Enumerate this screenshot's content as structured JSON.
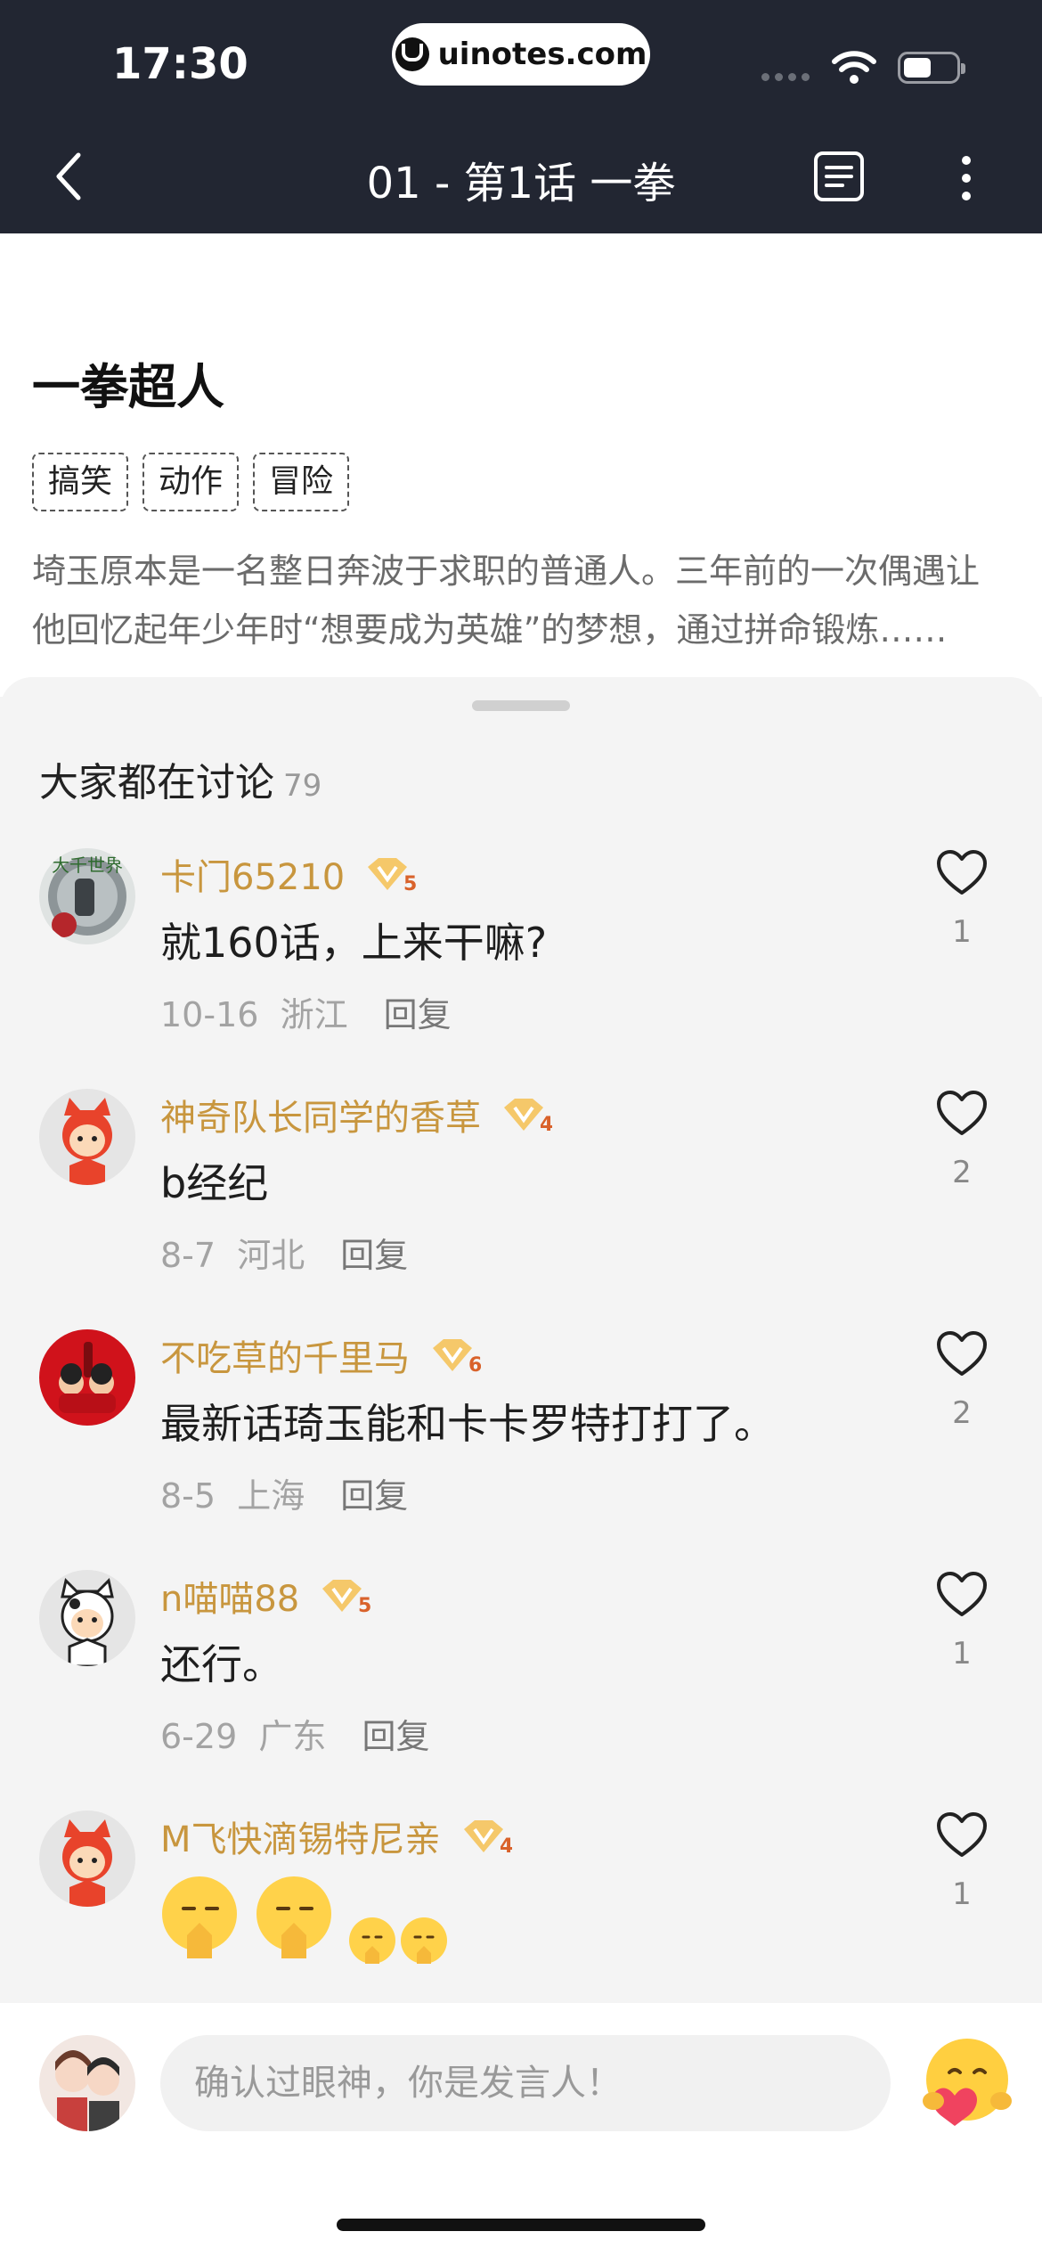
{
  "status_bar": {
    "time": "17:30",
    "site": "uinotes.com"
  },
  "nav": {
    "title": "01 - 第1话 一拳"
  },
  "book": {
    "title": "一拳超人",
    "tags": [
      "搞笑",
      "动作",
      "冒险"
    ],
    "description": "埼玉原本是一名整日奔波于求职的普通人。三年前的一次偶遇让他回忆起年少年时“想要成为英雄”的梦想，通过拼命锻炼……"
  },
  "comments_section": {
    "title": "大家都在讨论",
    "count": "79",
    "comments": [
      {
        "user": "卡门65210",
        "level": "5",
        "text": "就160话，上来干嘛?",
        "date": "10-16",
        "location": "浙江",
        "reply": "回复",
        "likes": "1",
        "avatar": "photo-avatar"
      },
      {
        "user": "神奇队长同学的香草",
        "level": "4",
        "text": "b经纪",
        "date": "8-7",
        "location": "河北",
        "reply": "回复",
        "likes": "2",
        "avatar": "red-kid-avatar"
      },
      {
        "user": "不吃草的千里马",
        "level": "6",
        "text": "最新话琦玉能和卡卡罗特打打了。",
        "date": "8-5",
        "location": "上海",
        "reply": "回复",
        "likes": "2",
        "avatar": "cola-avatar"
      },
      {
        "user": "n喵喵88",
        "level": "5",
        "text": "还行。",
        "date": "6-29",
        "location": "广东",
        "reply": "回复",
        "likes": "1",
        "avatar": "cow-kid-avatar"
      },
      {
        "user": "M飞快滴锡特尼亲",
        "level": "4",
        "text": "",
        "date": "",
        "location": "",
        "reply": "",
        "likes": "1",
        "avatar": "red-kid-avatar",
        "emoji_names": [
          "praying-face-emoji",
          "praying-face-emoji",
          "praying-face-emoji",
          "praying-face-emoji"
        ]
      }
    ]
  },
  "composer": {
    "placeholder": "确认过眼神，你是发言人！"
  },
  "colors": {
    "header_bg": "#222632",
    "username": "#c8963e",
    "sheet_bg": "#f4f4f4"
  }
}
